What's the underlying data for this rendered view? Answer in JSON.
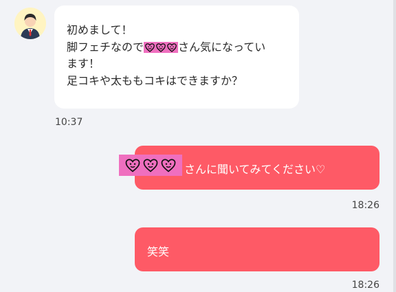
{
  "messages": {
    "incoming": {
      "line1": "初めまして！",
      "line2_before": "脚フェチなので",
      "line2_after": "さん気になってい",
      "line3": "ます！",
      "line4": "足コキや太ももコキはできますか？",
      "time": "10:37"
    },
    "outgoing1": {
      "text": "さんに聞いてみてください♡",
      "time": "18:26"
    },
    "outgoing2": {
      "text": "笑笑",
      "time": "18:26"
    }
  },
  "colors": {
    "background": "#f2f3f7",
    "incoming_bubble": "#ffffff",
    "outgoing_bubble": "#fe5a66",
    "redaction": "#ef6fbf"
  },
  "icons": [
    "avatar-man-icon",
    "heart-face-icon"
  ]
}
